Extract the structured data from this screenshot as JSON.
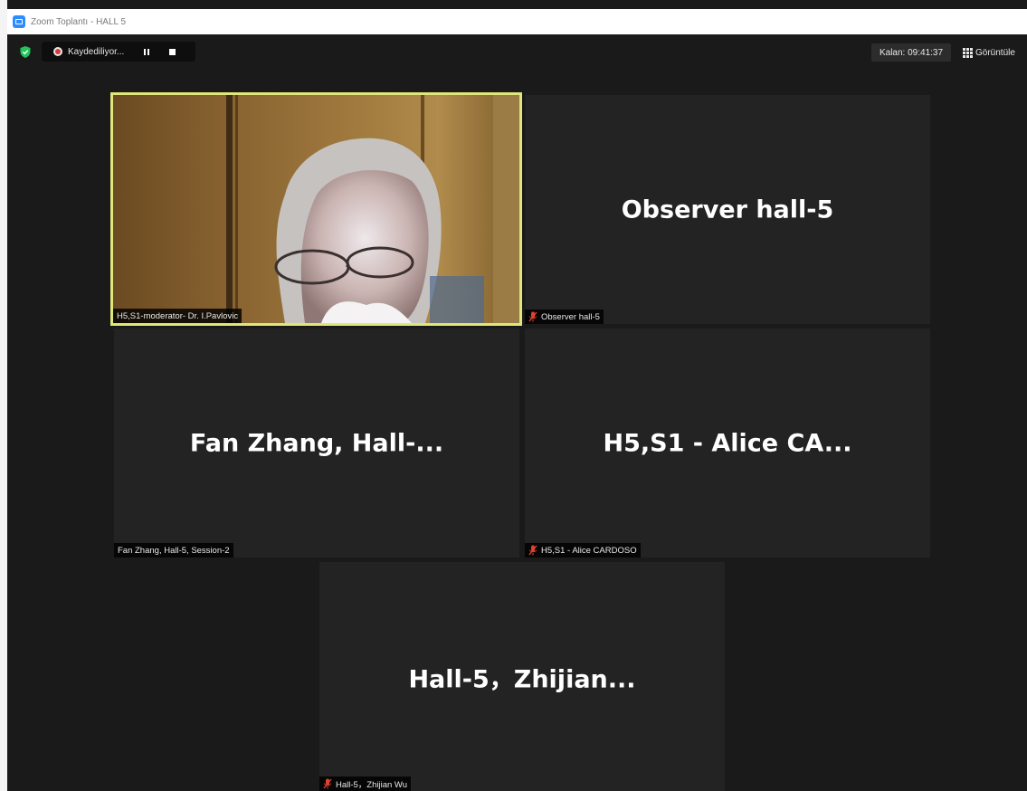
{
  "window": {
    "title": "Zoom Toplantı - HALL 5",
    "icon": "zoom-app-icon"
  },
  "toolbar": {
    "security_icon": "shield-check-icon",
    "recording_label": "Kaydediliyor...",
    "pause_icon": "pause-icon",
    "stop_icon": "stop-icon",
    "timer_text": "Kalan: 09:41:37",
    "view_label": "Görüntüle",
    "view_icon": "grid-icon"
  },
  "participants": [
    {
      "display_name": "",
      "name_label": "H5,S1-moderator- Dr. I.Pavlovic",
      "muted": false,
      "video_on": true,
      "active_speaker": true
    },
    {
      "display_name": "Observer hall-5",
      "name_label": "Observer hall-5",
      "muted": true,
      "video_on": false
    },
    {
      "display_name": "Fan Zhang, Hall-...",
      "name_label": "Fan Zhang, Hall-5, Session-2",
      "muted": false,
      "video_on": false
    },
    {
      "display_name": "H5,S1 - Alice CA...",
      "name_label": "H5,S1 - Alice CARDOSO",
      "muted": true,
      "video_on": false
    },
    {
      "display_name": "Hall-5，Zhijian...",
      "name_label": "Hall-5，Zhijian Wu",
      "muted": true,
      "video_on": false
    }
  ],
  "colors": {
    "active_speaker_border": "#dfe67a",
    "mute_icon": "#e0422f",
    "tile_bg": "#232323",
    "app_blue": "#2d8cff",
    "shield_green": "#23c35b"
  }
}
